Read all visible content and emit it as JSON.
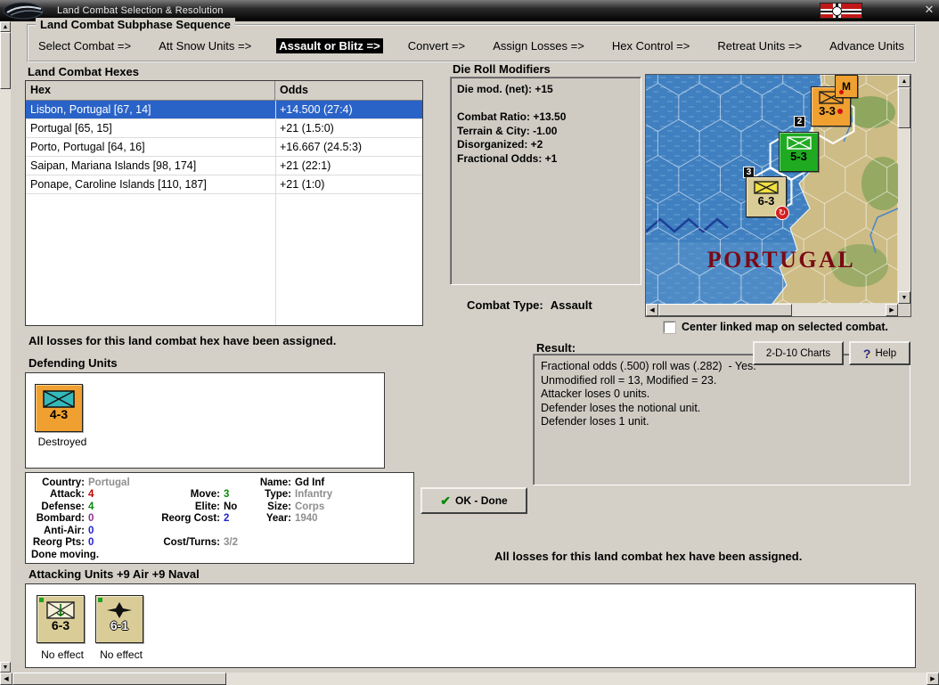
{
  "window": {
    "title": "Land Combat Selection & Resolution"
  },
  "sequence": {
    "title": "Land Combat Subphase Sequence",
    "steps": [
      "Select Combat =>",
      "Att Snow Units =>",
      "Assault or Blitz =>",
      "Convert =>",
      "Assign Losses =>",
      "Hex Control =>",
      "Retreat Units =>",
      "Advance Units"
    ]
  },
  "hex_table": {
    "title": "Land Combat Hexes",
    "columns": [
      "Hex",
      "Odds"
    ],
    "rows": [
      {
        "hex": "Lisbon, Portugal [67, 14]",
        "odds": "+14.500 (27:4)"
      },
      {
        "hex": "Portugal [65, 15]",
        "odds": "+21 (1.5:0)"
      },
      {
        "hex": "Porto, Portugal [64, 16]",
        "odds": "+16.667 (24.5:3)"
      },
      {
        "hex": "Saipan, Mariana Islands [98, 174]",
        "odds": "+21 (22:1)"
      },
      {
        "hex": "Ponape, Caroline Islands [110, 187]",
        "odds": "+21 (1:0)"
      }
    ]
  },
  "die_roll_modifiers": {
    "title": "Die Roll Modifiers",
    "text": "Die mod. (net): +15\n\nCombat Ratio: +13.50\nTerrain & City: -1.00\nDisorganized: +2\nFractional Odds: +1"
  },
  "combat_type": {
    "label": "Combat Type:",
    "value": "Assault"
  },
  "messages": {
    "losses_assigned_top": "All losses for this land combat hex have been assigned.",
    "losses_assigned_bottom": "All losses for this land combat hex have been assigned."
  },
  "defending": {
    "title": "Defending Units",
    "unit": {
      "strength": "4-3",
      "status": "Destroyed"
    }
  },
  "unit_details": {
    "country_label": "Country:",
    "country": "Portugal",
    "attack_label": "Attack:",
    "attack": "4",
    "defense_label": "Defense:",
    "defense": "4",
    "bombard_label": "Bombard:",
    "bombard": "0",
    "anti_air_label": "Anti-Air:",
    "anti_air": "0",
    "reorg_pts_label": "Reorg Pts:",
    "reorg_pts": "0",
    "move_label": "Move:",
    "move": "3",
    "elite_label": "Elite:",
    "elite": "No",
    "reorg_cost_label": "Reorg Cost:",
    "reorg_cost": "2",
    "cost_turns_label": "Cost/Turns:",
    "cost_turns": "3/2",
    "name_label": "Name:",
    "name": "Gd Inf",
    "type_label": "Type:",
    "type": "Infantry",
    "size_label": "Size:",
    "size": "Corps",
    "year_label": "Year:",
    "year": "1940",
    "done_moving": "Done moving."
  },
  "result": {
    "title": "Result:",
    "text": "Fractional odds (.500) roll was (.282)  - Yes.\nUnmodified roll = 13, Modified = 23.\nAttacker loses 0 units.\nDefender loses the notional unit.\nDefender loses 1 unit."
  },
  "buttons": {
    "ok": "OK - Done",
    "charts": "2-D-10 Charts",
    "help": "Help"
  },
  "map_panel": {
    "region_label": "PORTUGAL",
    "checkbox_label": "Center linked map on selected combat.",
    "units": [
      {
        "strength": "3-3",
        "badge": "M"
      },
      {
        "strength": "5-3"
      },
      {
        "strength": "6-3"
      }
    ],
    "hexside_numbers": [
      "2",
      "3"
    ]
  },
  "attacking": {
    "title": "Attacking Units +9 Air +9 Naval",
    "units": [
      {
        "strength": "6-3",
        "status": "No effect"
      },
      {
        "strength": "6-1",
        "status": "No effect"
      }
    ]
  }
}
